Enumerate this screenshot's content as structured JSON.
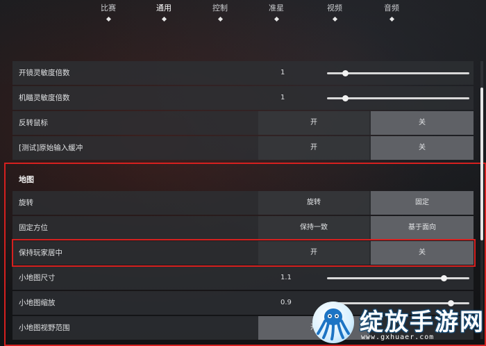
{
  "tabs": [
    {
      "label": "比赛"
    },
    {
      "label": "通用",
      "active": true
    },
    {
      "label": "控制"
    },
    {
      "label": "准星"
    },
    {
      "label": "视频"
    },
    {
      "label": "音频"
    }
  ],
  "settings": {
    "scope_sensitivity": {
      "label": "开镜灵敏度倍数",
      "value": "1",
      "slider_fraction": 0.13
    },
    "aim_sensitivity": {
      "label": "机瞄灵敏度倍数",
      "value": "1",
      "slider_fraction": 0.13
    },
    "invert_mouse": {
      "label": "反转鼠标",
      "on": "开",
      "off": "关",
      "selected": "off"
    },
    "raw_input_buffer": {
      "label": "[测试]原始输入缓冲",
      "on": "开",
      "off": "关",
      "selected": "off"
    }
  },
  "map_section": {
    "title": "地图",
    "rotate": {
      "label": "旋转",
      "option_a": "旋转",
      "option_b": "固定",
      "selected": "b"
    },
    "fixed_orientation": {
      "label": "固定方位",
      "option_a": "保持一致",
      "option_b": "基于面向",
      "selected": "b"
    },
    "keep_player_centered": {
      "label": "保持玩家居中",
      "on": "开",
      "off": "关",
      "selected": "off"
    },
    "minimap_size": {
      "label": "小地图尺寸",
      "value": "1.1",
      "slider_fraction": 0.82
    },
    "minimap_zoom": {
      "label": "小地图缩放",
      "value": "0.9",
      "slider_fraction": 0.87
    },
    "minimap_view_range": {
      "label": "小地图视野范围",
      "on": "开"
    }
  },
  "watermark": {
    "title": "绽放手游网",
    "url": "www.gxhuaer.com"
  },
  "colors": {
    "highlight": "#d6201f",
    "selected_option": "#5f6166",
    "row_bg": "#2d2f33"
  }
}
